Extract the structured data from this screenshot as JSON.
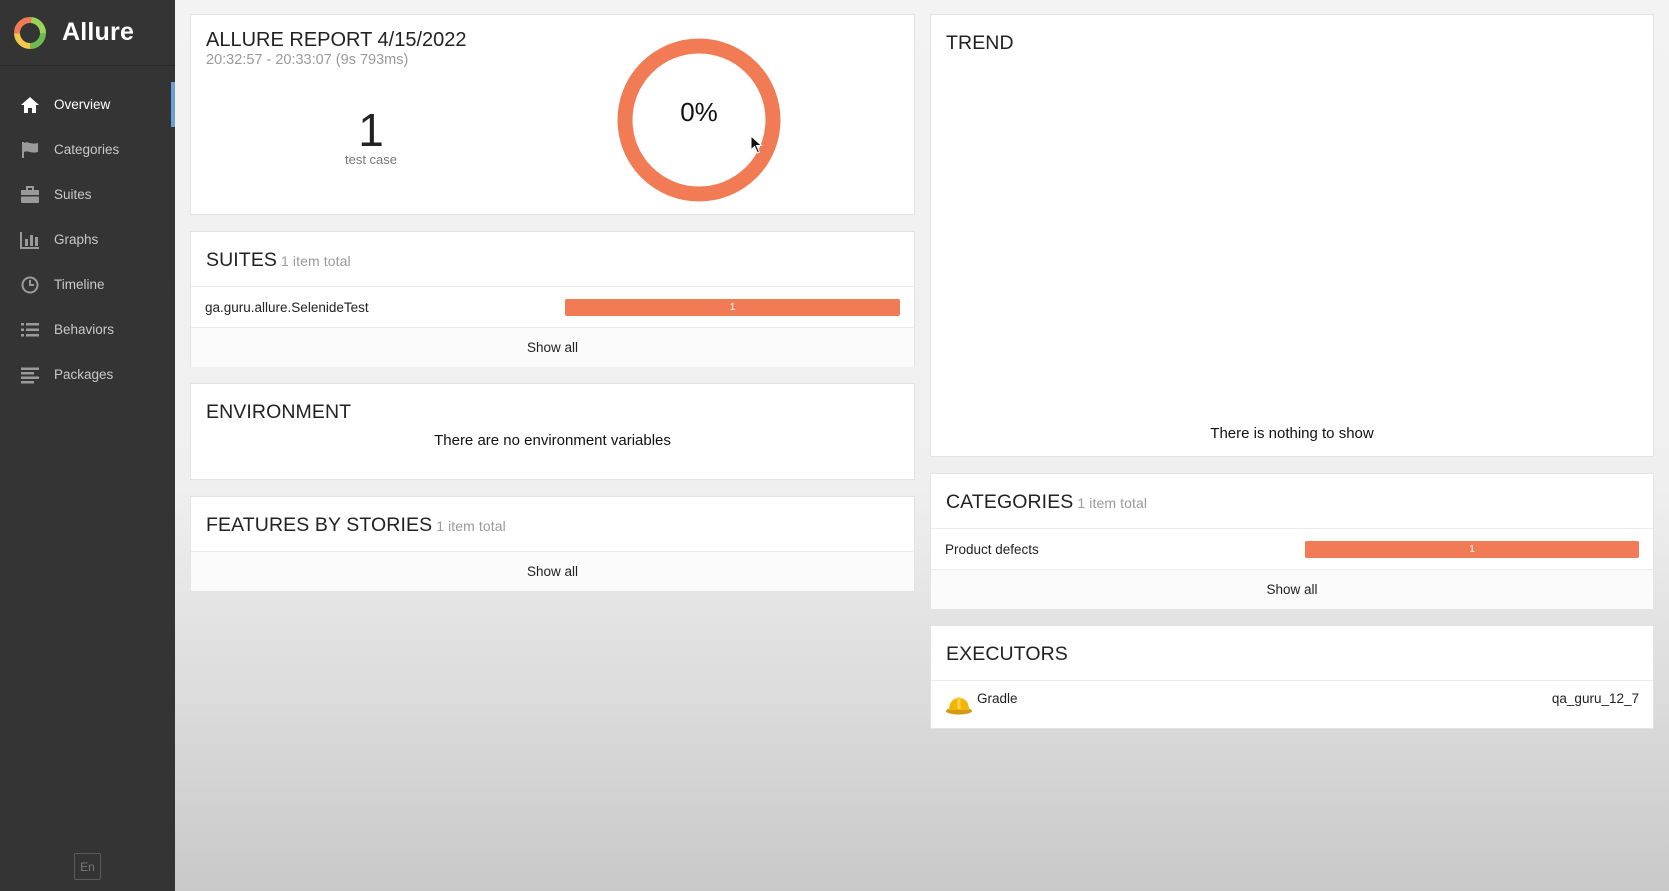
{
  "app": {
    "name": "Allure",
    "language": "En"
  },
  "sidebar": {
    "items": [
      {
        "label": "Overview",
        "icon": "home-icon",
        "active": true
      },
      {
        "label": "Categories",
        "icon": "flag-icon",
        "active": false
      },
      {
        "label": "Suites",
        "icon": "briefcase-icon",
        "active": false
      },
      {
        "label": "Graphs",
        "icon": "bar-chart-icon",
        "active": false
      },
      {
        "label": "Timeline",
        "icon": "clock-icon",
        "active": false
      },
      {
        "label": "Behaviors",
        "icon": "list-icon",
        "active": false
      },
      {
        "label": "Packages",
        "icon": "align-left-icon",
        "active": false
      }
    ]
  },
  "summary": {
    "title": "ALLURE REPORT 4/15/2022",
    "time": "20:32:57 - 20:33:07 (9s 793ms)",
    "count": "1",
    "count_label": "test case",
    "pass_rate": "0%",
    "pass_rate_fraction": 0
  },
  "suites": {
    "title": "SUITES",
    "subtitle": "1 item total",
    "items": [
      {
        "name": "ga.guru.allure.SelenideTest",
        "value": "1"
      }
    ],
    "show_all": "Show all"
  },
  "environment": {
    "title": "ENVIRONMENT",
    "message": "There are no environment variables"
  },
  "features": {
    "title": "FEATURES BY STORIES",
    "subtitle": "1 item total",
    "show_all": "Show all"
  },
  "trend": {
    "title": "TREND",
    "message": "There is nothing to show"
  },
  "categories": {
    "title": "CATEGORIES",
    "subtitle": "1 item total",
    "items": [
      {
        "name": "Product defects",
        "value": "1"
      }
    ],
    "show_all": "Show all"
  },
  "executors": {
    "title": "EXECUTORS",
    "items": [
      {
        "name": "Gradle",
        "build": "qa_guru_12_7",
        "icon": "hard-hat-icon"
      }
    ]
  },
  "colors": {
    "sidebar_bg": "#343434",
    "accent_active": "#6a9fd8",
    "failed": "#f07b54"
  }
}
